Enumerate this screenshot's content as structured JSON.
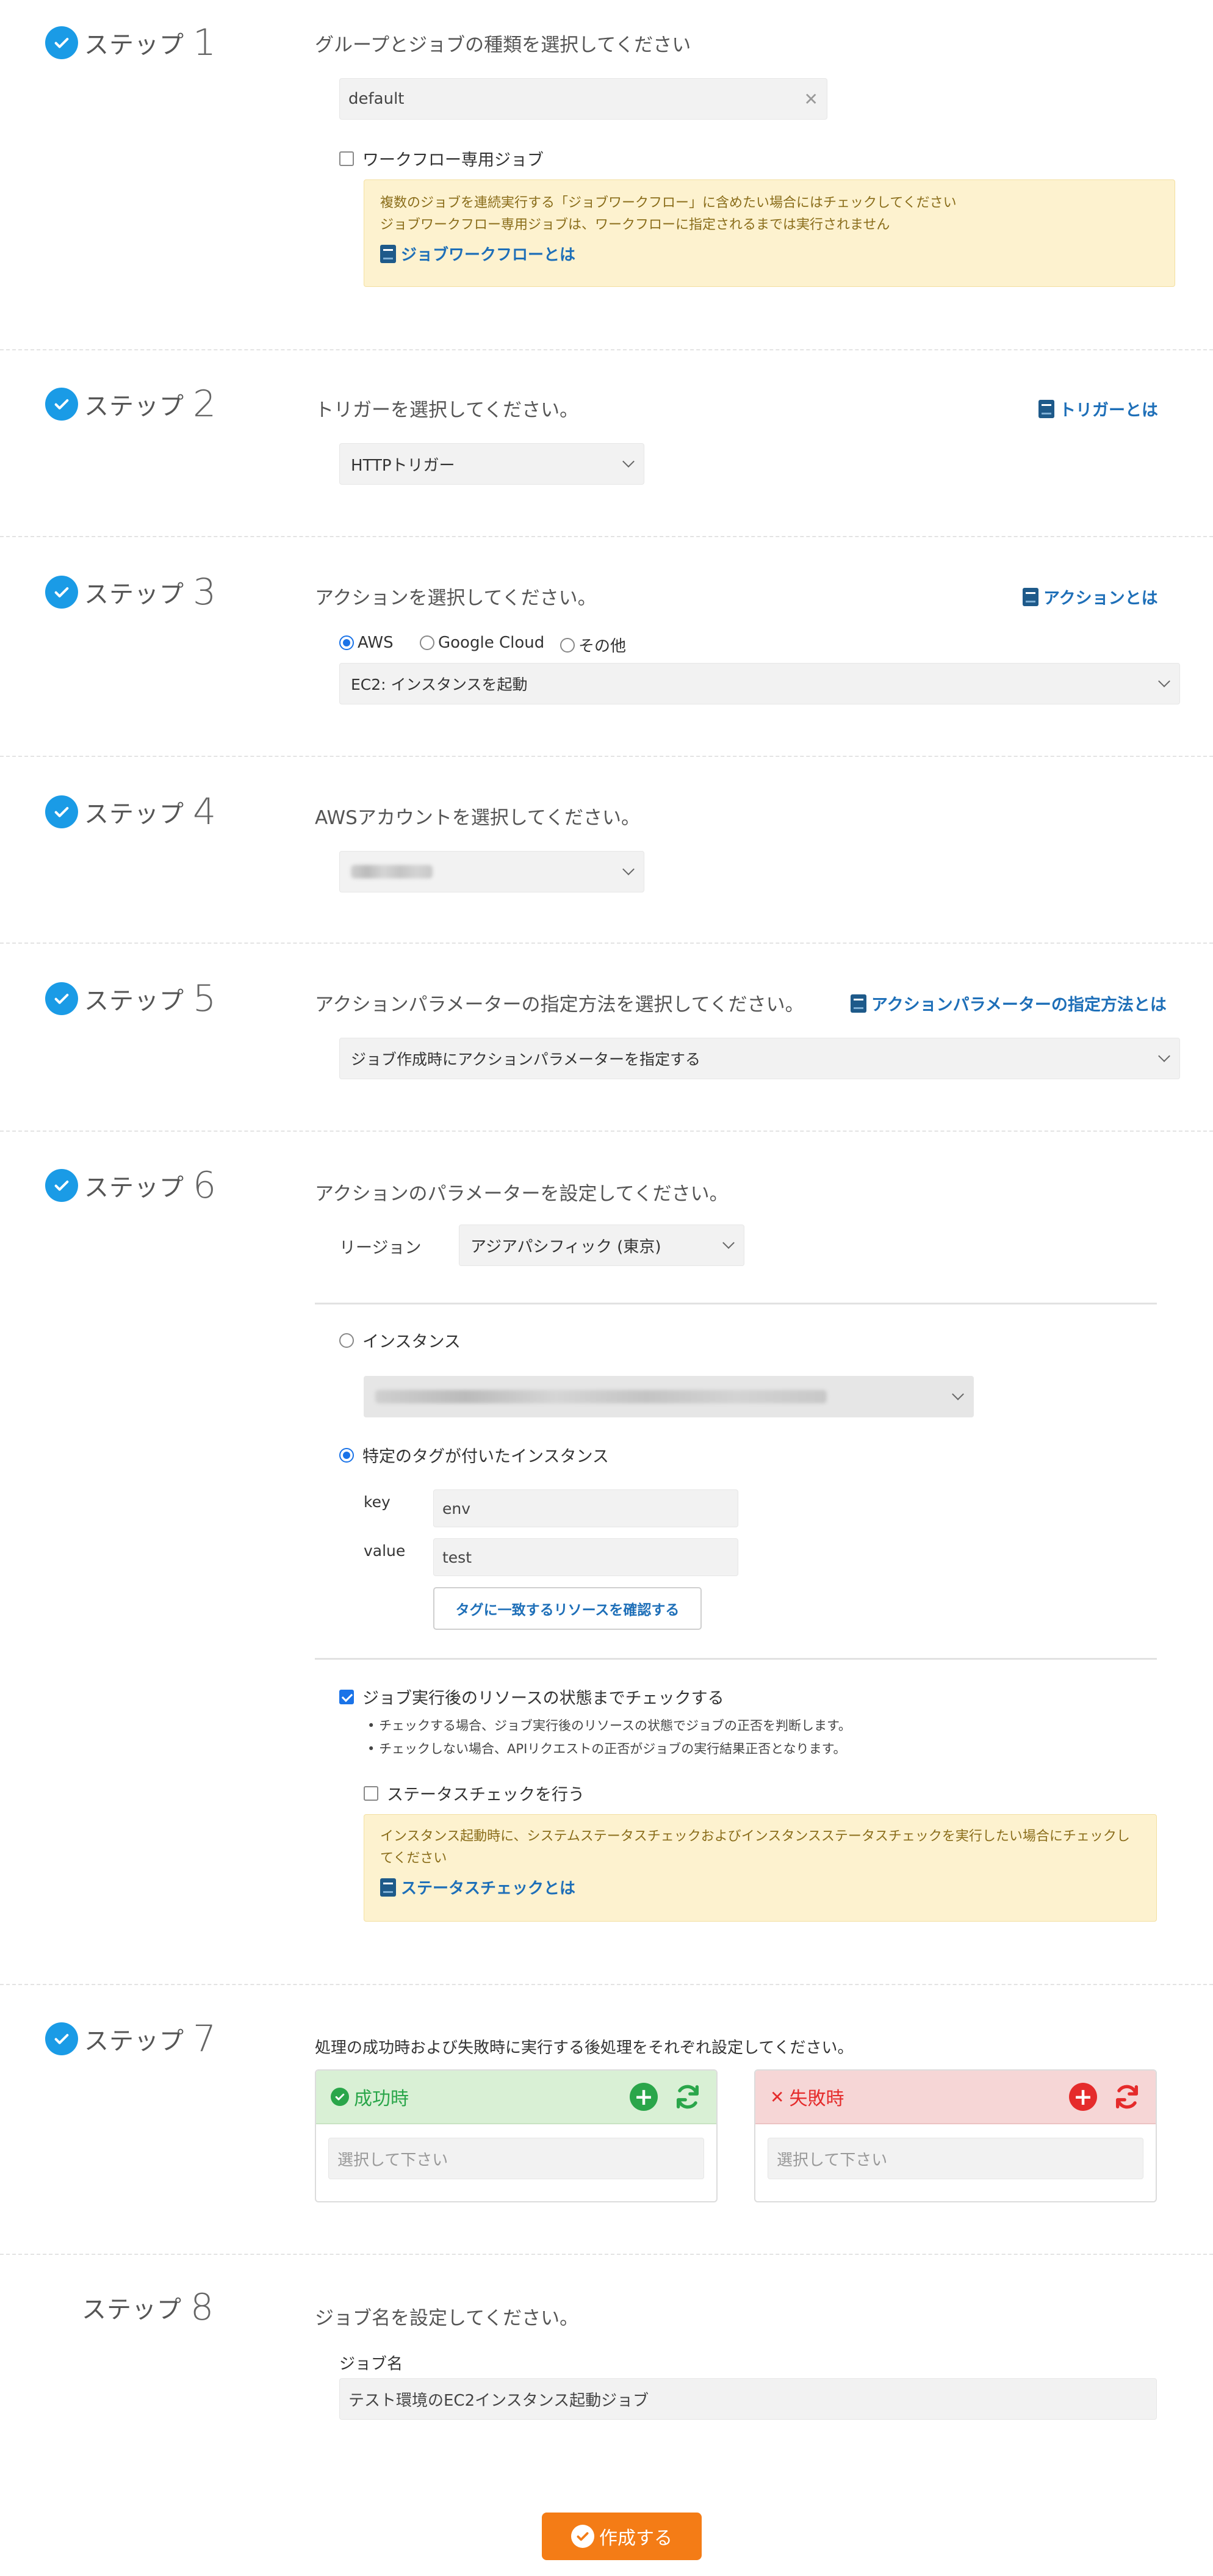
{
  "steps": {
    "s1": {
      "word": "ステップ",
      "num": "1"
    },
    "s2": {
      "word": "ステップ",
      "num": "2"
    },
    "s3": {
      "word": "ステップ",
      "num": "3"
    },
    "s4": {
      "word": "ステップ",
      "num": "4"
    },
    "s5": {
      "word": "ステップ",
      "num": "5"
    },
    "s6": {
      "word": "ステップ",
      "num": "6"
    },
    "s7": {
      "word": "ステップ",
      "num": "7"
    },
    "s8": {
      "word": "ステップ",
      "num": "8"
    }
  },
  "step1": {
    "heading": "グループとジョブの種類を選択してください",
    "group_value": "default",
    "clear_icon": "✕",
    "workflow_only_label": "ワークフロー専用ジョブ",
    "note_line1": "複数のジョブを連続実行する「ジョブワークフロー」に含めたい場合にはチェックしてください",
    "note_line2": "ジョブワークフロー専用ジョブは、ワークフローに指定されるまでは実行されません",
    "note_link": "ジョブワークフローとは"
  },
  "step2": {
    "heading": "トリガーを選択してください。",
    "link": "トリガーとは",
    "trigger_value": "HTTPトリガー"
  },
  "step3": {
    "heading": "アクションを選択してください。",
    "link": "アクションとは",
    "providers": [
      "AWS",
      "Google Cloud",
      "その他"
    ],
    "selected_provider": "AWS",
    "action_value": "EC2: インスタンスを起動"
  },
  "step4": {
    "heading": "AWSアカウントを選択してください。"
  },
  "step5": {
    "heading": "アクションパラメーターの指定方法を選択してください。",
    "link": "アクションパラメーターの指定方法とは",
    "method_value": "ジョブ作成時にアクションパラメーターを指定する"
  },
  "step6": {
    "heading": "アクションのパラメーターを設定してください。",
    "region_label": "リージョン",
    "region_value": "アジアパシフィック (東京)",
    "instance_label": "インスタンス",
    "tagged_label": "特定のタグが付いたインスタンス",
    "key_label": "key",
    "key_value": "env",
    "value_label": "value",
    "value_value": "test",
    "confirm_button": "タグに一致するリソースを確認する",
    "check_state_label": "ジョブ実行後のリソースの状態までチェックする",
    "bullet1": "チェックする場合、ジョブ実行後のリソースの状態でジョブの正否を判断します。",
    "bullet2": "チェックしない場合、APIリクエストの正否がジョブの実行結果正否となります。",
    "status_check_label": "ステータスチェックを行う",
    "note_line1": "インスタンス起動時に、システムステータスチェックおよびインスタンスステータスチェックを実行したい場合にチェックし",
    "note_line2": "てください",
    "note_link": "ステータスチェックとは"
  },
  "step7": {
    "heading": "処理の成功時および失敗時に実行する後処理をそれぞれ設定してください。",
    "success_title": "成功時",
    "failure_title": "失敗時",
    "success_placeholder": "選択して下さい",
    "failure_placeholder": "選択して下さい",
    "plus": "+",
    "fail_mark": "✕"
  },
  "step8": {
    "heading": "ジョブ名を設定してください。",
    "name_label": "ジョブ名",
    "name_value": "テスト環境のEC2インスタンス起動ジョブ"
  },
  "create_button": "作成する",
  "colors": {
    "accent_blue": "#1a9be6",
    "link_blue": "#1e6fb8",
    "success_green": "#2aa64a",
    "failure_red": "#e52b2b",
    "create_orange": "#f47c16",
    "note_bg": "#fdf2cf"
  }
}
